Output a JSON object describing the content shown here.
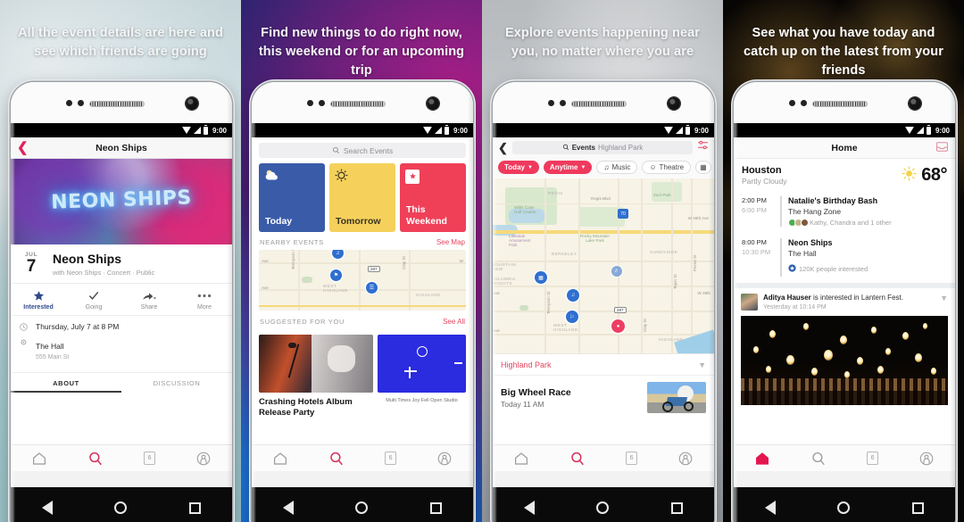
{
  "panels": [
    {
      "headline": "All the event details are here and see which friends are going",
      "status": {
        "time": "9:00"
      },
      "app": {
        "title": "Neon Ships",
        "hero_text": "NEON SHIPS",
        "date_month": "JUL",
        "date_day": "7",
        "event_name": "Neon Ships",
        "event_meta": "with Neon Ships · Concert · Public",
        "actions": [
          {
            "label": "Interested",
            "icon": "star-icon",
            "active": true
          },
          {
            "label": "Going",
            "icon": "check-icon",
            "active": false
          },
          {
            "label": "Share",
            "icon": "share-arrow-icon",
            "active": false
          },
          {
            "label": "More",
            "icon": "ellipsis-icon",
            "active": false
          }
        ],
        "when": "Thursday, July 7 at 8 PM",
        "venue": "The Hall",
        "address": "555 Main St",
        "tabs": [
          {
            "label": "ABOUT",
            "active": true
          },
          {
            "label": "DISCUSSION",
            "active": false
          }
        ]
      }
    },
    {
      "headline": "Find new things to do right now, this weekend or for an upcoming trip",
      "status": {
        "time": "9:00"
      },
      "app": {
        "search_placeholder": "Search Events",
        "tiles": [
          {
            "label": "Today",
            "color": "#3a5ba8",
            "icon": "weather-cloud-icon"
          },
          {
            "label": "Tomorrow",
            "color": "#f5d15c",
            "icon": "sun-icon"
          },
          {
            "label": "This Weekend",
            "color": "#ef4058",
            "icon": "ticket-icon"
          }
        ],
        "nearby_heading": "NEARBY EVENTS",
        "nearby_action": "See Map",
        "suggested_heading": "SUGGESTED FOR YOU",
        "suggested_action": "See All",
        "cards": [
          {
            "title": "Crashing Hotels Album Release Party"
          },
          {
            "caption": "Multi Times Joy Fell Open Studio"
          }
        ]
      }
    },
    {
      "headline": "Explore events happening near you, no matter where you are",
      "status": {
        "time": "9:00"
      },
      "app": {
        "search_prefix": "Events",
        "search_value": "Highland Park",
        "chips": [
          {
            "label": "Today",
            "style": "red",
            "caret": true
          },
          {
            "label": "Anytime",
            "style": "red",
            "caret": true
          },
          {
            "label": "Music",
            "style": "out",
            "icon": "music-note-icon"
          },
          {
            "label": "Theatre",
            "style": "out",
            "icon": "masks-icon"
          }
        ],
        "map_labels": [
          "REGIS",
          "Regis Blvd",
          "Zuni Park",
          "W 46th Ave",
          "Rocky Mountain Lake Park",
          "BERKELEY",
          "SUNNYSIDE",
          "WEST HIGHLAND",
          "HIGHLAND",
          "MOUNTAIN VIEW",
          "COLUMBIA HEIGHTS",
          "Willis Case Golf Course",
          "Lakeside Amusement Park",
          "Tennyson St",
          "Clay St",
          "Pecos St",
          "Tejon St",
          "W 38th Ave",
          "70",
          "287"
        ],
        "location_label": "Highland Park",
        "event": {
          "name": "Big Wheel Race",
          "when": "Today 11 AM"
        }
      }
    },
    {
      "headline": "See what you have today and catch up on the latest from your friends",
      "status": {
        "time": "9:00"
      },
      "app": {
        "title": "Home",
        "weather": {
          "city": "Houston",
          "condition": "Partly Cloudy",
          "temp": "68°"
        },
        "schedule": [
          {
            "start": "2:00 PM",
            "end": "6:00 PM",
            "title": "Natalie's Birthday Bash",
            "venue": "The Hang Zone",
            "social": "Kathy, Chandra and 1 other"
          },
          {
            "start": "8:00 PM",
            "end": "10:30 PM",
            "title": "Neon Ships",
            "venue": "The Hall",
            "social": "120K people interested"
          }
        ],
        "post": {
          "actor": "Aditya Hauser",
          "action": " is interested in Lantern Fest.",
          "meta": "Yesterday at 10:14 PM"
        }
      }
    }
  ],
  "tabbar": {
    "items": [
      {
        "name": "home",
        "icon": "home-icon"
      },
      {
        "name": "search",
        "icon": "search-icon"
      },
      {
        "name": "events",
        "icon": "calendar-badge-icon",
        "badge": "6"
      },
      {
        "name": "profile",
        "icon": "person-icon"
      }
    ]
  },
  "android_nav": {
    "back": "back-triangle-icon",
    "home": "home-circle-icon",
    "recents": "recents-square-icon"
  },
  "colors": {
    "accent_pink": "#e4455f",
    "chip_red": "#ef3a5d",
    "tile_blue": "#3a5ba8",
    "tile_yellow": "#f5d15c",
    "tile_red": "#ef4058"
  }
}
